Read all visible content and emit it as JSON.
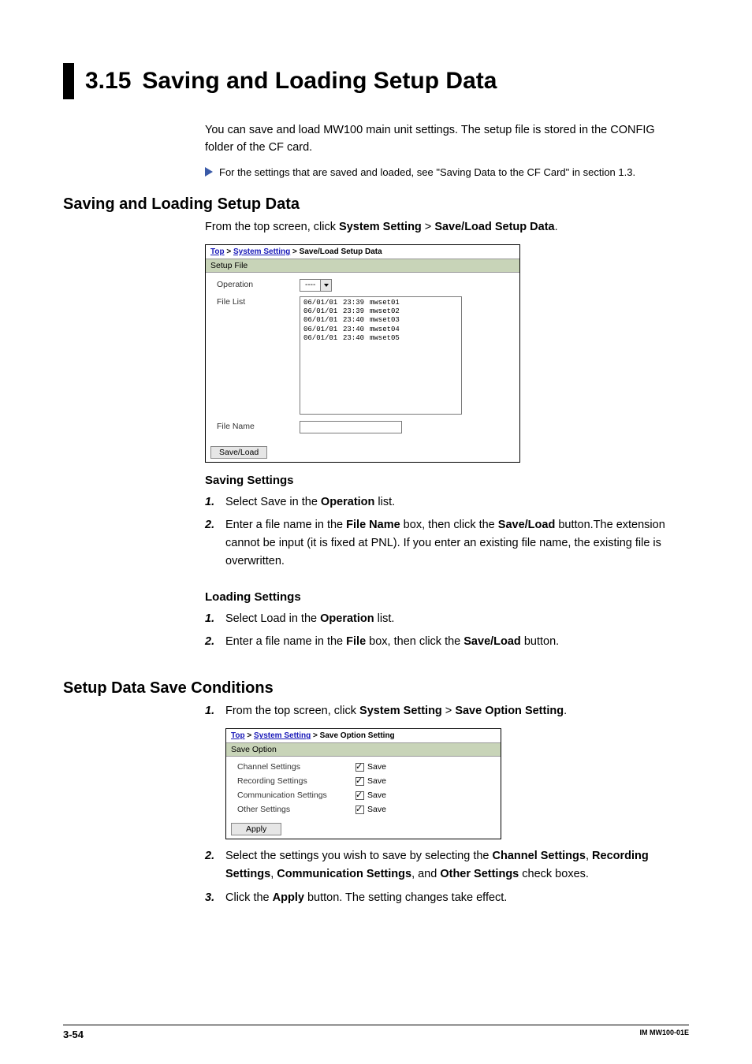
{
  "section": {
    "number": "3.15",
    "title": "Saving and Loading Setup Data",
    "intro": "You can save and load MW100 main unit settings. The setup file is stored in the CONFIG folder of the CF card.",
    "note": "For the settings that are saved and loaded, see \"Saving Data to the CF Card\" in section 1.3."
  },
  "sub1": {
    "heading": "Saving and Loading Setup Data",
    "leadin_pre": "From the top screen, click ",
    "leadin_b1": "System Setting",
    "leadin_mid": " > ",
    "leadin_b2": "Save/Load Setup Data",
    "leadin_post": "."
  },
  "shot1": {
    "bc_top": "Top",
    "bc_mid": "System Setting",
    "bc_last": "Save/Load Setup Data",
    "panel": "Setup File",
    "lbl_operation": "Operation",
    "sel_operation": "----",
    "lbl_filelist": "File List",
    "files": [
      {
        "date": "06/01/01",
        "time": "23:39",
        "name": "mwset01"
      },
      {
        "date": "06/01/01",
        "time": "23:39",
        "name": "mwset02"
      },
      {
        "date": "06/01/01",
        "time": "23:40",
        "name": "mwset03"
      },
      {
        "date": "06/01/01",
        "time": "23:40",
        "name": "mwset04"
      },
      {
        "date": "06/01/01",
        "time": "23:40",
        "name": "mwset05"
      }
    ],
    "lbl_filename": "File Name",
    "val_filename": "",
    "btn": "Save/Load"
  },
  "saving": {
    "heading": "Saving Settings",
    "s1_a": "Select Save in the ",
    "s1_b": "Operation",
    "s1_c": " list.",
    "s2_a": "Enter a file name in the ",
    "s2_b": "File Name",
    "s2_c": " box, then click the ",
    "s2_d": "Save/Load",
    "s2_e": " button.The extension cannot be input (it is fixed at PNL). If you enter an existing file name, the existing file is overwritten."
  },
  "loading": {
    "heading": "Loading Settings",
    "s1_a": "Select Load in the ",
    "s1_b": "Operation",
    "s1_c": " list.",
    "s2_a": "Enter a file name in the ",
    "s2_b": "File",
    "s2_c": " box, then click the ",
    "s2_d": "Save/Load",
    "s2_e": " button."
  },
  "sub2": {
    "heading": "Setup Data Save Conditions",
    "s1_a": "From the top screen, click ",
    "s1_b": "System Setting",
    "s1_c": " > ",
    "s1_d": "Save Option Setting",
    "s1_e": "."
  },
  "shot2": {
    "bc_top": "Top",
    "bc_mid": "System Setting",
    "bc_last": "Save Option Setting",
    "panel": "Save Option",
    "rows": [
      {
        "label": "Channel Settings",
        "cb": "Save"
      },
      {
        "label": "Recording Settings",
        "cb": "Save"
      },
      {
        "label": "Communication Settings",
        "cb": "Save"
      },
      {
        "label": "Other Settings",
        "cb": "Save"
      }
    ],
    "btn": "Apply"
  },
  "sub2steps": {
    "s2_a": "Select the settings you wish to save by selecting the ",
    "s2_b": "Channel Settings",
    "s2_c": ", ",
    "s2_d": "Recording Settings",
    "s2_e": ", ",
    "s2_f": "Communication Settings",
    "s2_g": ", and ",
    "s2_h": "Other Settings",
    "s2_i": " check boxes.",
    "s3_a": "Click the ",
    "s3_b": "Apply",
    "s3_c": " button. The setting changes take effect."
  },
  "footer": {
    "page": "3-54",
    "doc": "IM MW100-01E"
  }
}
